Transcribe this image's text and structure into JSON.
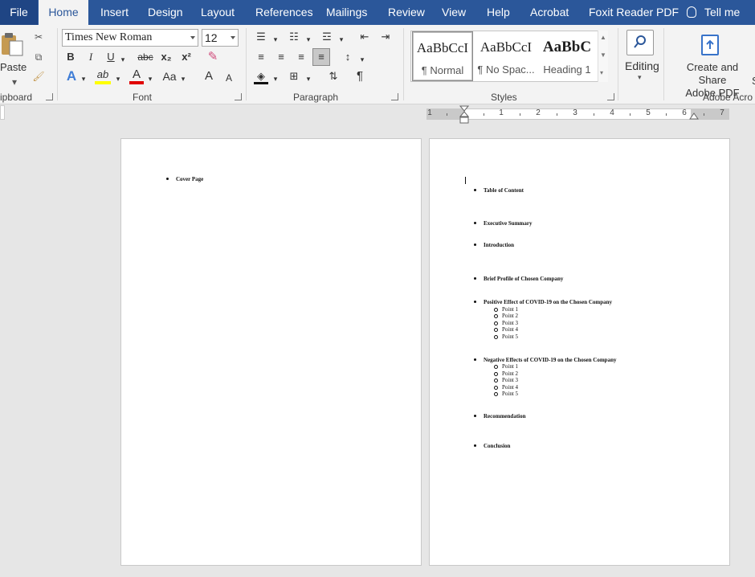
{
  "tabs": [
    {
      "label": "File"
    },
    {
      "label": "Home"
    },
    {
      "label": "Insert"
    },
    {
      "label": "Design"
    },
    {
      "label": "Layout"
    },
    {
      "label": "References"
    },
    {
      "label": "Mailings"
    },
    {
      "label": "Review"
    },
    {
      "label": "View"
    },
    {
      "label": "Help"
    },
    {
      "label": "Acrobat"
    },
    {
      "label": "Foxit Reader PDF"
    }
  ],
  "tell_me": "Tell me",
  "ribbon": {
    "clipboard": {
      "paste": "Paste",
      "group": "ipboard"
    },
    "font": {
      "name": "Times New Roman",
      "size": "12",
      "group": "Font",
      "bold": "B",
      "italic": "I",
      "underline": "U",
      "strike": "abc",
      "sub": "x₂",
      "sup": "x²",
      "effects": "A",
      "highlight": "ab",
      "color": "A",
      "case": "Aa",
      "grow": "A",
      "shrink": "A"
    },
    "paragraph": {
      "group": "Paragraph",
      "pilcrow": "¶"
    },
    "styles": {
      "group": "Styles",
      "items": [
        {
          "sample": "AaBbCcI",
          "name": "¶ Normal"
        },
        {
          "sample": "AaBbCcI",
          "name": "¶ No Spac..."
        },
        {
          "sample": "AaBbC",
          "name": "Heading 1"
        }
      ]
    },
    "editing": {
      "label": "Editing"
    },
    "acrobat": {
      "line1": "Create and Share",
      "line2": "Adobe PDF",
      "group": "Adobe Acro",
      "edge": "S"
    }
  },
  "ruler": {
    "labels": [
      "1",
      "1",
      "2",
      "3",
      "4",
      "5",
      "6",
      "7"
    ]
  },
  "page1": {
    "items": [
      "Cover Page"
    ]
  },
  "page2": {
    "items": [
      {
        "text": "Table of Content"
      },
      {
        "text": "Executive Summary"
      },
      {
        "text": "Introduction"
      },
      {
        "text": "Brief Profile of Chosen Company"
      },
      {
        "text": "Positive Effect of COVID-19 on the Chosen Company",
        "subs": [
          "Point 1",
          "Point 2",
          "Point 3",
          "Point 4",
          "Point 5"
        ]
      },
      {
        "text": "Negative Effects of COVID-19 on the Chosen Company",
        "subs": [
          "Point 1",
          "Point 2",
          "Point 3",
          "Point 4",
          "Point 5"
        ]
      },
      {
        "text": "Recommendation"
      },
      {
        "text": "Conclusion"
      }
    ]
  },
  "colors": {
    "ribbon_blue": "#2b579a",
    "highlight_yellow": "#ffff00",
    "font_red": "#e00000"
  }
}
